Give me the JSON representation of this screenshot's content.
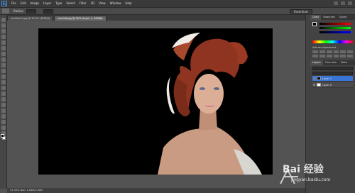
{
  "menubar": {
    "logo": "Ps",
    "items": [
      "File",
      "Edit",
      "Image",
      "Layer",
      "Type",
      "Select",
      "Filter",
      "3D",
      "View",
      "Window",
      "Help"
    ]
  },
  "options": {
    "label": "Radius:",
    "workspace": "Essentials"
  },
  "document": {
    "tabs": [
      "untitled-1.jpg @ 33.3% (RGB/8)",
      "scarlett.jpg @ 50% (Layer 1, RGB/8)"
    ],
    "active_tab": 1,
    "status": "33.33%   Doc: 2.64M/5.28M"
  },
  "panels": {
    "top_tabs": [
      "Color",
      "Swatches",
      "Styles"
    ],
    "adjustments_title": "Add an adjustment",
    "layer_tabs": [
      "Layers",
      "Channels",
      "Paths"
    ],
    "layers": [
      {
        "name": "Layer 1",
        "active": true,
        "thumb": "black"
      },
      {
        "name": "Layer 0",
        "active": false,
        "thumb": "white"
      }
    ]
  },
  "watermark": {
    "logo": "Bai 经验",
    "url": "jingyan.baidu.com"
  },
  "colors": {
    "canvas_bg": "#000000",
    "ui_bg": "#535353",
    "selected_layer": "#3875d7"
  }
}
